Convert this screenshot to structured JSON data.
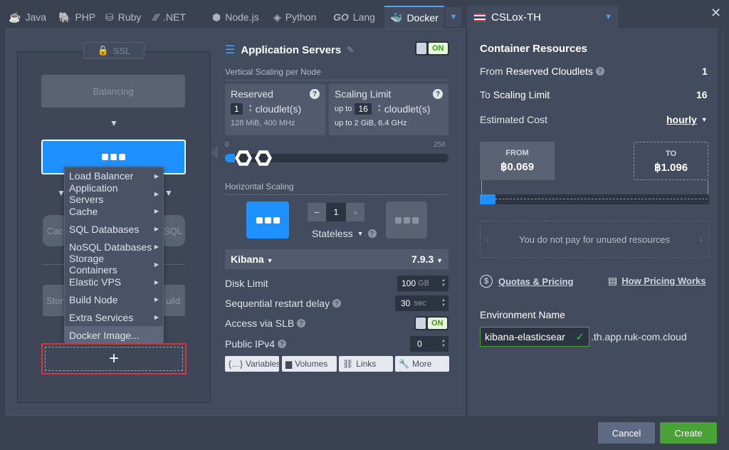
{
  "tabs": [
    {
      "label": "Java",
      "icon": "java-icon",
      "glyph": "☕"
    },
    {
      "label": "PHP",
      "icon": "php-icon",
      "glyph": "🐘"
    },
    {
      "label": "Ruby",
      "icon": "ruby-icon",
      "glyph": "⛁"
    },
    {
      "label": ".NET",
      "icon": "dotnet-icon",
      "glyph": "∕∕∕"
    },
    {
      "label": "Node.js",
      "icon": "nodejs-icon",
      "glyph": "⬢"
    },
    {
      "label": "Python",
      "icon": "python-icon",
      "glyph": "◈"
    },
    {
      "label": "Lang",
      "icon": "go-icon",
      "glyph": "GO"
    },
    {
      "label": "Docker",
      "icon": "docker-icon",
      "glyph": "🐳"
    }
  ],
  "region": {
    "label": "CSLox-TH"
  },
  "topology": {
    "ssl_label": "SSL",
    "balancing_label": "Balancing",
    "cache_label": "Cac",
    "sql_label": "SQL",
    "storage_label": "Stor",
    "build_label": "uild"
  },
  "context_menu": {
    "items": [
      "Load Balancer",
      "Application Servers",
      "Cache",
      "SQL Databases",
      "NoSQL Databases",
      "Storage Containers",
      "Elastic VPS",
      "Build Node",
      "Extra Services",
      "Docker Image..."
    ]
  },
  "app_servers": {
    "title": "Application Servers",
    "toggle": "ON",
    "vertical_label": "Vertical Scaling per Node",
    "reserved": {
      "title": "Reserved",
      "count": "1",
      "unit": "cloudlet(s)",
      "info": "128 MiB, 400 MHz"
    },
    "limit": {
      "title": "Scaling Limit",
      "upto": "up to",
      "count": "16",
      "unit": "cloudlet(s)",
      "info_upto": "up to",
      "info": "2 GiB, 6.4 GHz"
    },
    "slider": {
      "min": "0",
      "max": "256",
      "reserved": 1,
      "limit": 16
    },
    "horizontal_label": "Horizontal Scaling",
    "nodes": "1",
    "stateless": "Stateless",
    "image": "Kibana",
    "version": "7.9.3",
    "disk_limit_label": "Disk Limit",
    "disk_limit_value": "100",
    "disk_limit_unit": "GB",
    "restart_label": "Sequential restart delay",
    "restart_value": "30",
    "restart_unit": "sec",
    "slb_label": "Access via SLB",
    "slb_toggle": "ON",
    "ipv4_label": "Public IPv4",
    "ipv4_value": "0",
    "buttons": [
      "Variables",
      "Volumes",
      "Links",
      "More"
    ]
  },
  "resources": {
    "title": "Container Resources",
    "reserved_prefix": "From",
    "reserved_label": "Reserved Cloudlets",
    "reserved_value": "1",
    "limit_prefix": "To",
    "limit_label": "Scaling Limit",
    "limit_value": "16",
    "cost_label": "Estimated Cost",
    "cost_period": "hourly",
    "from_label": "FROM",
    "from_value": "฿0.069",
    "to_label": "TO",
    "to_value": "฿1.096",
    "note": "You do not pay for unused resources",
    "quotas_link": "Quotas & Pricing",
    "pricing_link": "How Pricing Works",
    "env_label": "Environment Name",
    "env_value": "kibana-elasticsear",
    "env_domain": ".th.app.ruk-com.cloud"
  },
  "footer": {
    "cancel": "Cancel",
    "create": "Create"
  },
  "colors": {
    "accent": "#1e90ff",
    "create": "#48a235",
    "highlight": "#d3363a"
  }
}
